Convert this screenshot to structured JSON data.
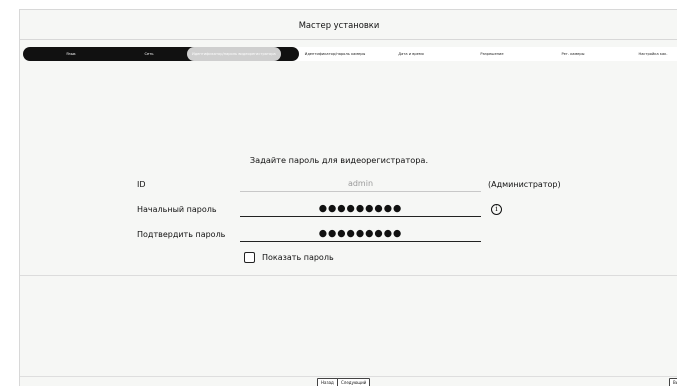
{
  "window": {
    "title": "Мастер установки"
  },
  "steps": [
    {
      "label": "Язык",
      "state": "done"
    },
    {
      "label": "Сеть",
      "state": "done"
    },
    {
      "label": "Идентификатор/пароль видеорегистратора",
      "state": "current"
    },
    {
      "label": "Идентификатор/пароль камеры",
      "state": "pending"
    },
    {
      "label": "Дата и время",
      "state": "pending"
    },
    {
      "label": "Разрешение",
      "state": "pending"
    },
    {
      "label": "Рег. камеры",
      "state": "pending"
    },
    {
      "label": "Настройка как.",
      "state": "pending"
    }
  ],
  "form": {
    "prompt": "Задайте пароль для видеорегистратора.",
    "id_label": "ID",
    "id_value": "admin",
    "id_suffix": "(Администратор)",
    "initial_password_label": "Начальный пароль",
    "initial_password_value": "●●●●●●●●●",
    "confirm_password_label": "Подтвердить пароль",
    "confirm_password_value": "●●●●●●●●●",
    "show_password_label": "Показать пароль",
    "show_password_checked": false,
    "info_icon": "info-circle-icon"
  },
  "footer": {
    "back_label": "Назад",
    "next_label": "Следующий",
    "exit_label": "Вы"
  }
}
